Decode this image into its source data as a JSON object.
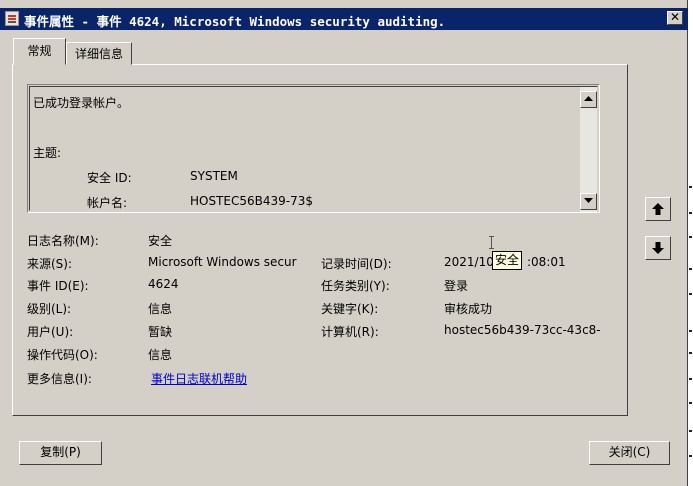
{
  "window": {
    "title": "事件属性 - 事件 4624, Microsoft Windows security auditing.",
    "close_glyph": "✕"
  },
  "tabs": [
    {
      "label": "常规",
      "selected": true
    },
    {
      "label": "详细信息",
      "selected": false
    }
  ],
  "description": {
    "lines": [
      "已成功登录帐户。",
      "主题:"
    ],
    "rows": [
      {
        "label": "安全 ID:",
        "value": "SYSTEM"
      },
      {
        "label": "帐户名:",
        "value": "HOSTEC56B439-73$"
      }
    ]
  },
  "fields": {
    "log_name": {
      "label": "日志名称(M):",
      "value": "安全"
    },
    "source": {
      "label": "来源(S):",
      "value": "Microsoft Windows secur"
    },
    "event_id": {
      "label": "事件 ID(E):",
      "value": "4624"
    },
    "level": {
      "label": "级别(L):",
      "value": "信息"
    },
    "user": {
      "label": "用户(U):",
      "value": "暂缺"
    },
    "opcode": {
      "label": "操作代码(O):",
      "value": "信息"
    },
    "more_info": {
      "label": "更多信息(I):",
      "value": "事件日志联机帮助"
    },
    "logged": {
      "label": "记录时间(D):",
      "value_left": "2021/10",
      "value_right": ":08:01"
    },
    "task_category": {
      "label": "任务类别(Y):",
      "value": "登录"
    },
    "keywords": {
      "label": "关键字(K):",
      "value": "审核成功"
    },
    "computer": {
      "label": "计算机(R):",
      "value": "hostec56b439-73cc-43c8-"
    }
  },
  "tooltip": {
    "text": "安全"
  },
  "buttons": {
    "copy": "复制(P)",
    "close": "关闭(C)"
  },
  "icons": {
    "scroll_up": "scroll-up-arrow-icon",
    "scroll_down": "scroll-down-arrow-icon",
    "prev_event": "up-arrow-icon",
    "next_event": "down-arrow-icon",
    "window": "event-properties-icon"
  },
  "colors": {
    "titlebar": "#0a246a",
    "face": "#d4d0c8",
    "link": "#0000cc",
    "tooltip_bg": "#ffffe1"
  }
}
